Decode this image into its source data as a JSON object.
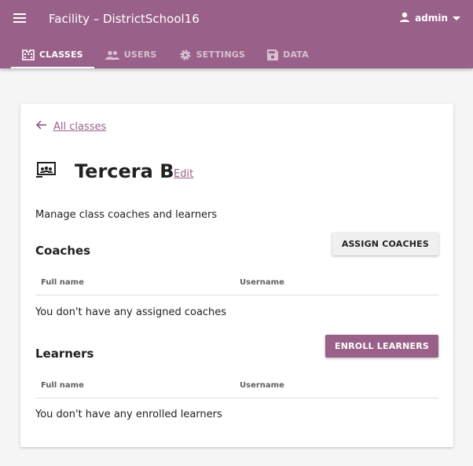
{
  "header": {
    "title": "Facility – DistrictSchool16",
    "user": "admin"
  },
  "tabs": [
    {
      "label": "CLASSES",
      "icon": "classes-icon",
      "active": true
    },
    {
      "label": "USERS",
      "icon": "users-icon",
      "active": false
    },
    {
      "label": "SETTINGS",
      "icon": "gear-icon",
      "active": false
    },
    {
      "label": "DATA",
      "icon": "save-icon",
      "active": false
    }
  ],
  "page": {
    "back_label": "All classes",
    "class_name": "Tercera B",
    "edit_label": "Edit",
    "description": "Manage class coaches and learners"
  },
  "coaches": {
    "title": "Coaches",
    "button": "ASSIGN COACHES",
    "columns": [
      "Full name",
      "Username"
    ],
    "empty": "You don't have any assigned coaches"
  },
  "learners": {
    "title": "Learners",
    "button": "ENROLL LEARNERS",
    "columns": [
      "Full name",
      "Username"
    ],
    "empty": "You don't have any enrolled learners"
  },
  "colors": {
    "brand": "#996189",
    "background": "#f5f5f5"
  }
}
